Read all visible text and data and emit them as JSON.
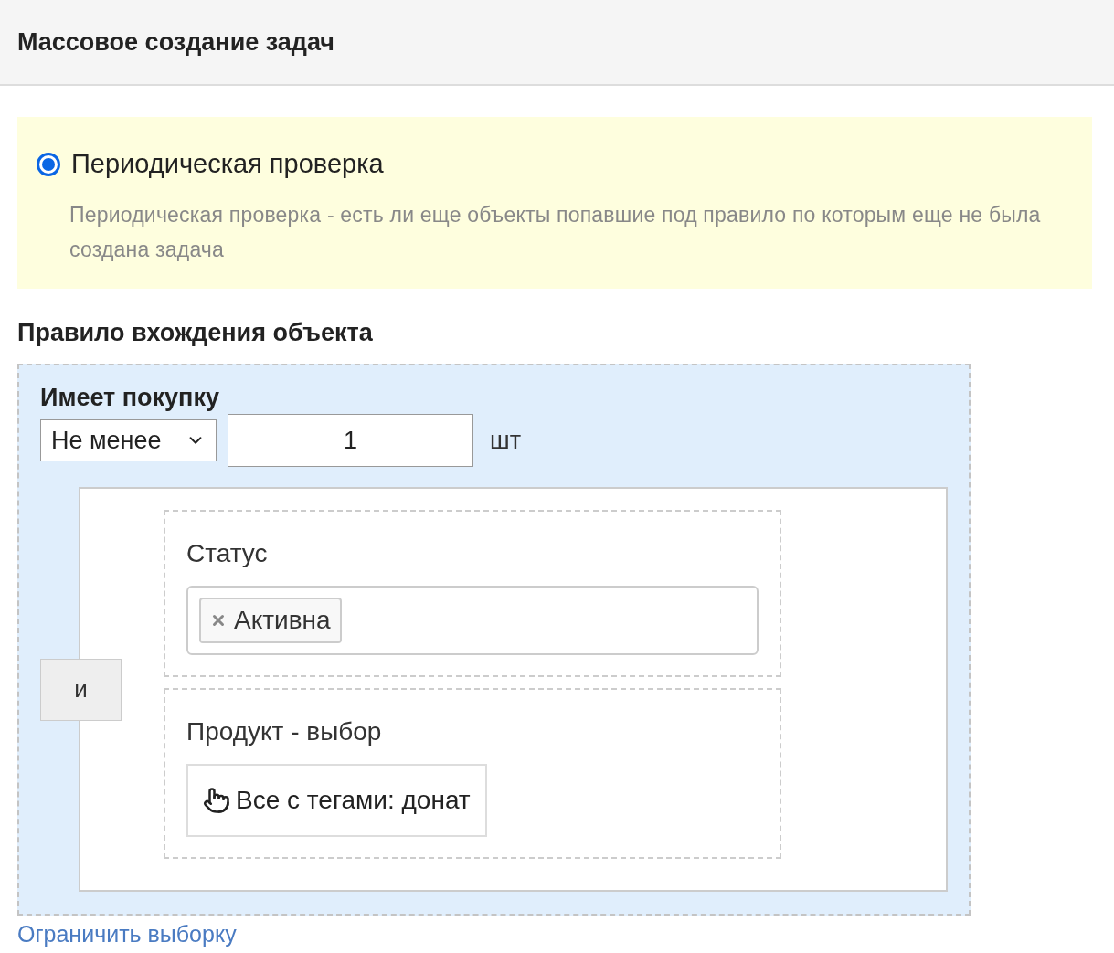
{
  "header": {
    "title": "Массовое создание задач"
  },
  "mode": {
    "label": "Периодическая проверка",
    "selected": true,
    "description": "Периодическая проверка - есть ли еще объекты попавшие под правило по которым еще не была создана задача"
  },
  "rule": {
    "heading": "Правило вхождения объекта",
    "condition": {
      "title": "Имеет покупку",
      "operator": "Не менее",
      "quantity": "1",
      "unit": "шт",
      "joiner": "и",
      "filters": [
        {
          "kind": "tags",
          "label": "Статус",
          "tags": [
            "Активна"
          ]
        },
        {
          "kind": "picker",
          "label": "Продукт - выбор",
          "value": "Все с тегами: донат"
        }
      ]
    }
  },
  "limit_link": "Ограничить выборку"
}
